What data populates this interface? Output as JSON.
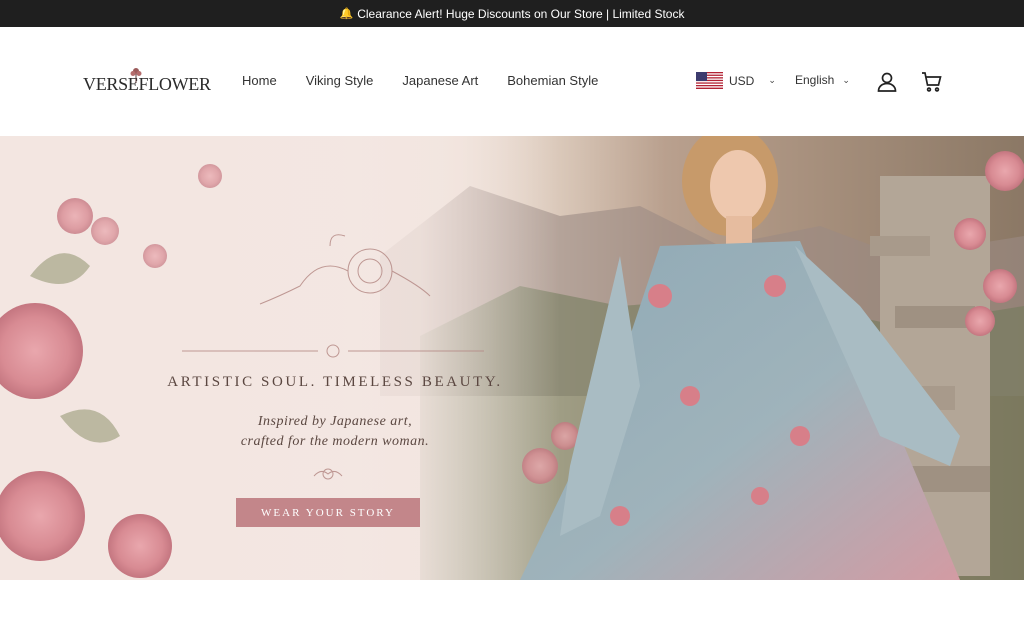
{
  "announcement": {
    "icon": "bell-icon",
    "text": "Clearance Alert! Huge Discounts on Our Store | Limited Stock"
  },
  "header": {
    "logo_text": "VERSEFLOWER",
    "nav": [
      {
        "label": "Home"
      },
      {
        "label": "Viking Style"
      },
      {
        "label": "Japanese Art"
      },
      {
        "label": "Bohemian Style"
      }
    ],
    "currency": {
      "code": "USD",
      "flag": "us-flag-icon"
    },
    "language": "English",
    "icons": [
      "account-icon",
      "cart-icon"
    ]
  },
  "hero": {
    "title": "ARTISTIC SOUL. TIMELESS BEAUTY.",
    "subtitle_line1": "Inspired by Japanese art,",
    "subtitle_line2": "crafted for the modern woman.",
    "cta_label": "WEAR YOUR STORY"
  },
  "colors": {
    "announcement_bg": "#1f1f1f",
    "cta_bg": "#c3868a",
    "hero_text": "#5b4741"
  }
}
